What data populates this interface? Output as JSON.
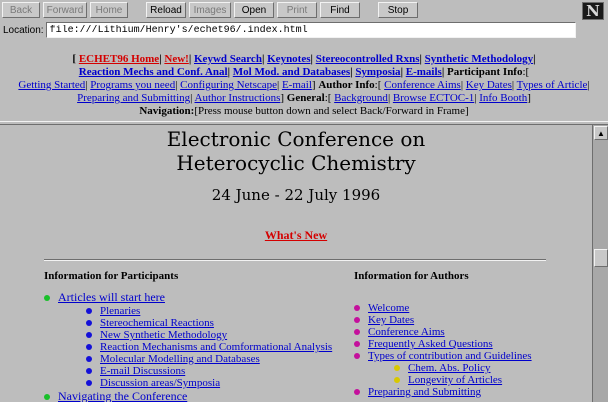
{
  "toolbar": {
    "buttons": [
      "Back",
      "Forward",
      "Home",
      "Reload",
      "Images",
      "Open",
      "Print",
      "Find",
      "Stop"
    ],
    "logo": "N"
  },
  "location": {
    "label": "Location:",
    "url": "file:///Lithium/Henry's/echet96/.index.html"
  },
  "nav": {
    "home": "ECHET96 Home",
    "new": "New!",
    "keywd": "Keywd Search",
    "keynotes": "Keynotes",
    "stereo": "Stereocontrolled Rxns",
    "synth": "Synthetic Methodology",
    "reaction": "Reaction Mechs and Conf. Anal",
    "molmod": "Mol Mod. and Databases",
    "symposia": "Symposia",
    "emails": "E-mails",
    "participant_info": "Participant Info",
    "getting_started": "Getting Started",
    "programs": "Programs you need",
    "netscape": "Configuring Netscape",
    "email": "E-mail",
    "author_info": "Author Info",
    "conf_aims": "Conference Aims",
    "key_dates": "Key Dates",
    "types": "Types of Article",
    "preparing": "Preparing and Submitting",
    "author_instructions": "Author Instructions",
    "general": "General",
    "background": "Background",
    "browse": "Browse ECTOC-1",
    "info_booth": "Info Booth",
    "navigation_label": "Navigation",
    "navigation_text": "[Press mouse button down and select Back/Forward in Frame]"
  },
  "main": {
    "title_line1": "Electronic Conference on",
    "title_line2": "Heterocyclic Chemistry",
    "dates": "24 June - 22 July 1996",
    "whats_new": "What's New",
    "participants_heading": "Information for Participants",
    "authors_heading": "Information for Authors",
    "participants": [
      {
        "label": "Articles will start here",
        "level": 0
      },
      {
        "label": "Plenaries",
        "level": 1
      },
      {
        "label": "Stereochemical Reactions",
        "level": 1
      },
      {
        "label": "New Synthetic Methodology",
        "level": 1
      },
      {
        "label": "Reaction Mechanisms and Comformational Analysis",
        "level": 1
      },
      {
        "label": "Molecular Modelling and Databases",
        "level": 1
      },
      {
        "label": "E-mail Discussions",
        "level": 1
      },
      {
        "label": "Discussion areas/Symposia",
        "level": 1
      },
      {
        "label": "Navigating the Conference",
        "level": 0
      }
    ],
    "authors": [
      {
        "label": "Welcome",
        "level": 0
      },
      {
        "label": "Key Dates",
        "level": 0
      },
      {
        "label": "Conference Aims",
        "level": 0
      },
      {
        "label": "Frequently Asked Questions",
        "level": 0
      },
      {
        "label": "Types of contribution and Guidelines",
        "level": 0
      },
      {
        "label": "Chem. Abs. Policy",
        "level": 1
      },
      {
        "label": "Longevity of Articles",
        "level": 1
      },
      {
        "label": "Preparing and Submitting",
        "level": 0
      }
    ]
  },
  "colors": {
    "link": "#0000cc",
    "red_link": "#d40000",
    "chrome": "#bdbdbd"
  }
}
